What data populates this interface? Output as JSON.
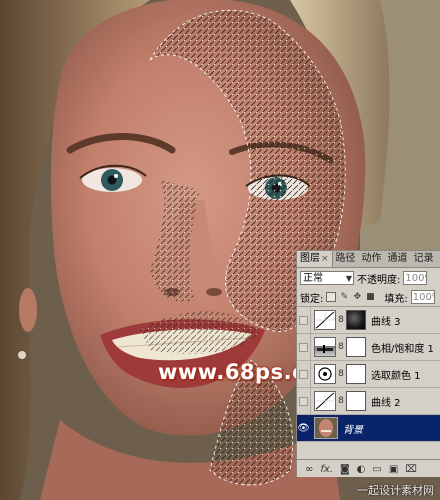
{
  "watermark": {
    "center_text": "www.68ps.com",
    "corner_text": "一起设计素材网"
  },
  "layers_panel": {
    "tabs": [
      {
        "label": "图层",
        "active": true,
        "closable": true
      },
      {
        "label": "路径"
      },
      {
        "label": "动作"
      },
      {
        "label": "通道"
      },
      {
        "label": "记录"
      }
    ],
    "blend_mode": "正常",
    "opacity_label": "不透明度:",
    "opacity_value": "100%",
    "lock_label": "锁定:",
    "fill_label": "填充:",
    "fill_value": "100%",
    "layers": [
      {
        "name": "曲线 3",
        "type": "curves",
        "mask": "dark",
        "visible": false
      },
      {
        "name": "色相/饱和度 1",
        "type": "hue-saturation",
        "mask": "white",
        "visible": false
      },
      {
        "name": "选取颜色 1",
        "type": "selective-color",
        "mask": "white",
        "visible": false
      },
      {
        "name": "曲线 2",
        "type": "curves",
        "mask": "white",
        "visible": false
      },
      {
        "name": "背景",
        "type": "background",
        "visible": true,
        "selected": true
      }
    ],
    "bottom_icons": [
      "link-icon",
      "fx-icon",
      "mask-icon",
      "adjustment-icon",
      "folder-icon",
      "new-layer-icon",
      "trash-icon"
    ]
  },
  "colors": {
    "selection_blue": "#0a246a",
    "panel_gray": "#d4d0c8",
    "watermark_red": "#b0361e"
  }
}
